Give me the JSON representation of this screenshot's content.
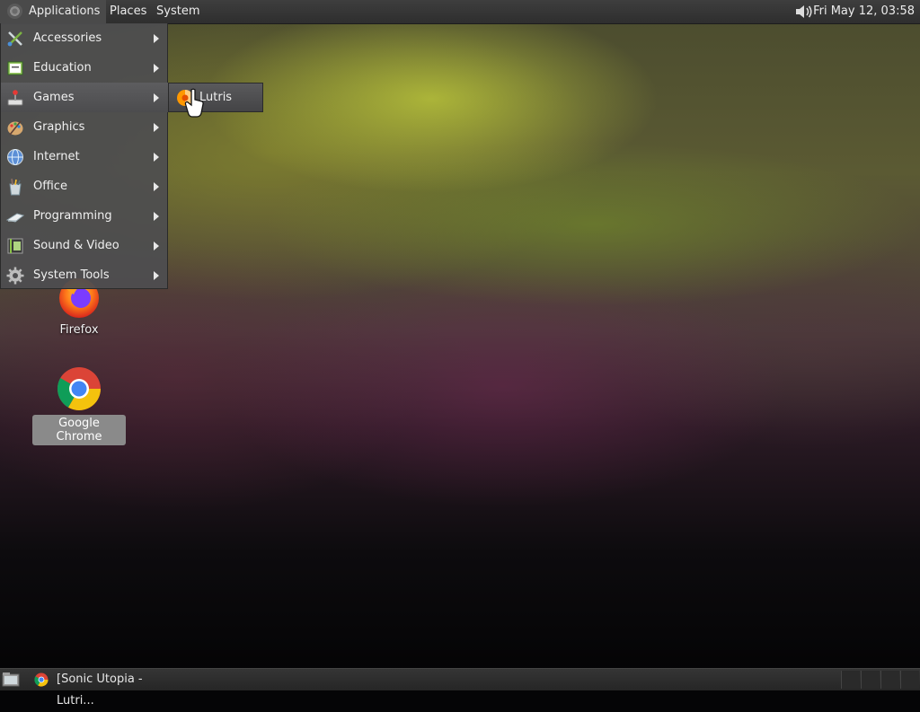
{
  "top_panel": {
    "menus": [
      "Applications",
      "Places",
      "System"
    ],
    "clock": "Fri May 12, 03:58",
    "volume_icon": "speaker-icon"
  },
  "apps_menu": {
    "items": [
      {
        "label": "Accessories",
        "icon": "accessories-icon"
      },
      {
        "label": "Education",
        "icon": "education-icon"
      },
      {
        "label": "Games",
        "icon": "games-icon"
      },
      {
        "label": "Graphics",
        "icon": "graphics-icon"
      },
      {
        "label": "Internet",
        "icon": "internet-icon"
      },
      {
        "label": "Office",
        "icon": "office-icon"
      },
      {
        "label": "Programming",
        "icon": "programming-icon"
      },
      {
        "label": "Sound & Video",
        "icon": "sound-video-icon"
      },
      {
        "label": "System Tools",
        "icon": "system-tools-icon"
      }
    ],
    "active_item": "Games"
  },
  "games_submenu": {
    "items": [
      {
        "label": "Lutris",
        "icon": "lutris-icon"
      }
    ]
  },
  "desktop": {
    "icons": [
      {
        "label": "Firefox",
        "icon": "firefox-icon"
      },
      {
        "label": "Google Chrome",
        "icon": "chrome-icon"
      }
    ]
  },
  "bottom_panel": {
    "task": {
      "label": "[Sonic Utopia - Lutri...",
      "icon": "chrome-icon"
    }
  }
}
